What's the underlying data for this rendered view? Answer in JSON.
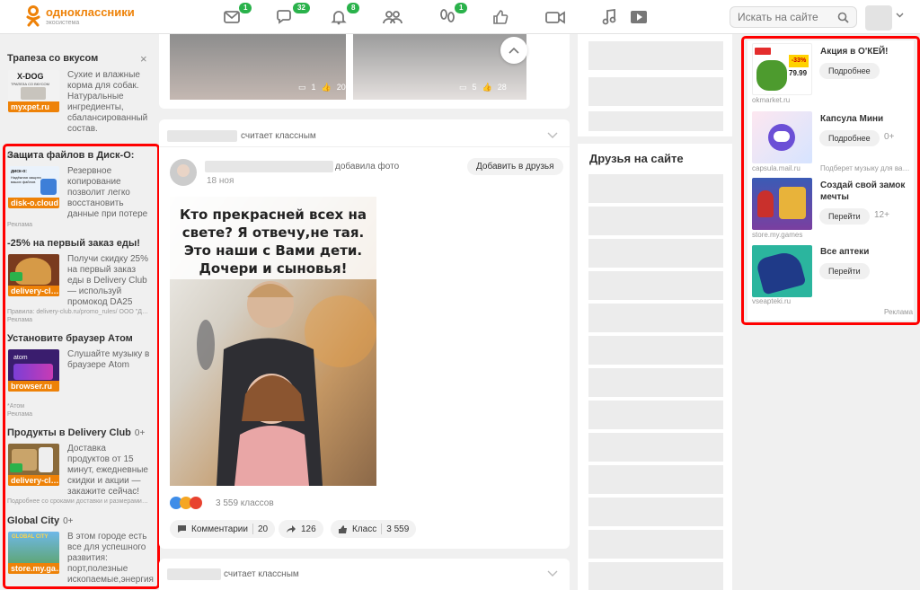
{
  "header": {
    "logo_title": "одноклассники",
    "logo_sub": "экосистема",
    "badges": {
      "messages": "1",
      "discussions": "32",
      "notifications": "8",
      "guests": "1"
    },
    "search_placeholder": "Искать на сайте"
  },
  "left_ads": [
    {
      "title": "Трапеза со вкусом",
      "img_label": "X-DOG",
      "img_sub": "ТРАПЕЗА СО ВКУСОМ",
      "source": "myxpet.ru",
      "desc": "Сухие и влажные корма для собак. Натуральные ингредиенты, сбалансированный состав.",
      "note": "Реклама"
    },
    {
      "title": "Защита файлов в Диск-О:",
      "img_label": "диск-о:",
      "img_sub": "Надёжная защита ваших файлов",
      "source": "disk-o.cloud",
      "desc": "Резервное копирование позволит легко восстановить данные при потере",
      "note": "Реклама"
    },
    {
      "title": "-25% на первый заказ еды!",
      "source": "delivery-cl…",
      "desc": "Получи скидку 25% на первый заказ еды в Delivery Club — используй промокод DA25",
      "note": "Правила: delivery-club.ru/promo_rules/ ООО \"Д…",
      "note2": "Реклама"
    },
    {
      "title": "Установите браузер Атом",
      "img_label": "atom",
      "source": "browser.ru",
      "desc": "Слушайте музыку в браузере Atom",
      "note": "*Атом",
      "note2": "Реклама"
    },
    {
      "title": "Продукты в Delivery Club",
      "age": "0+",
      "source": "delivery-cl…",
      "desc": "Доставка продуктов от 15 минут, ежедневные скидки и акции — закажите сейчас!",
      "note": "Подробнее со сроками доставки и размерами…"
    },
    {
      "title": "Global City",
      "age": "0+",
      "img_label": "GLOBAL CITY",
      "source": "store.my.ga…",
      "desc": "В этом городе есть все для успешного развития: порт,полезные ископаемые,энергия"
    }
  ],
  "close_icon": "×",
  "top_card": {
    "photo1": {
      "comments": "1",
      "likes": "20"
    },
    "photo2": {
      "comments": "5",
      "likes": "28"
    }
  },
  "post": {
    "header_action": "считает классным",
    "author_action": "добавила фото",
    "date": "18 ноя",
    "add_friend": "Добавить в друзья",
    "photo_text": "Кто прекрасней всех на свете? Я отвечу,не тая. Это наши с Вами дети. Дочери и сыновья!",
    "reactions_count": "3 559 классов",
    "comments_label": "Комментарии",
    "comments_count": "20",
    "shares_count": "126",
    "likes_label": "Класс",
    "likes_count": "3 559"
  },
  "next_card": {
    "header_action": "считает классным"
  },
  "friends": {
    "title": "Друзья на сайте"
  },
  "right_ads": [
    {
      "title": "Акция в О'КЕЙ!",
      "button": "Подробнее",
      "source": "okmarket.ru",
      "img_badge": "-33%",
      "img_price": "79.99"
    },
    {
      "title": "Капсула Мини",
      "button": "Подробнее",
      "age": "0+",
      "source": "capsula.mail.ru",
      "source2": "Подберет музыку для ва…"
    },
    {
      "title": "Создай свой замок мечты",
      "button": "Перейти",
      "age": "12+",
      "source": "store.my.games"
    },
    {
      "title": "Все аптеки",
      "button": "Перейти",
      "source": "vseapteki.ru"
    }
  ],
  "right_ads_note": "Реклама",
  "colors": {
    "brand": "#ee8208",
    "badge": "#2ab24b",
    "highlight": "#ff0000"
  }
}
